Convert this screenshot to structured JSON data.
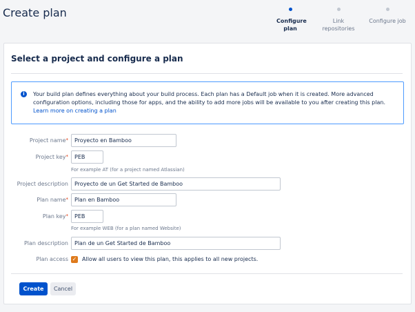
{
  "page": {
    "title": "Create plan"
  },
  "steps": [
    {
      "label": "Configure plan",
      "active": true
    },
    {
      "label": "Link repositories",
      "active": false
    },
    {
      "label": "Configure job",
      "active": false
    }
  ],
  "section": {
    "title": "Select a project and configure a plan"
  },
  "info": {
    "icon": "info-icon",
    "text": "Your build plan defines everything about your build process. Each plan has a Default job when it is created. More advanced configuration options, including those for apps, and the ability to add more jobs will be available to you after creating this plan.",
    "link": "Learn more on creating a plan"
  },
  "form": {
    "project_name": {
      "label": "Project name",
      "required_mark": "*",
      "value": "Proyecto en Bamboo"
    },
    "project_key": {
      "label": "Project key",
      "required_mark": "*",
      "value": "PEB",
      "hint": "For example AT (for a project named Atlassian)"
    },
    "project_description": {
      "label": "Project description",
      "value": "Proyecto de un Get Started de Bamboo"
    },
    "plan_name": {
      "label": "Plan name",
      "required_mark": "*",
      "value": "Plan en Bamboo"
    },
    "plan_key": {
      "label": "Plan key",
      "required_mark": "*",
      "value": "PEB",
      "hint": "For example WEB (for a plan named Website)"
    },
    "plan_description": {
      "label": "Plan description",
      "value": "Plan de un Get Started de Bamboo"
    },
    "plan_access": {
      "label": "Plan access",
      "checked": true,
      "checkbox_label": "Allow all users to view this plan, this applies to all new projects."
    }
  },
  "buttons": {
    "create": "Create",
    "cancel": "Cancel"
  },
  "colors": {
    "primary": "#0052cc",
    "checkbox": "#de7a1c",
    "required": "#de350b",
    "info_border": "#4c9aff"
  }
}
